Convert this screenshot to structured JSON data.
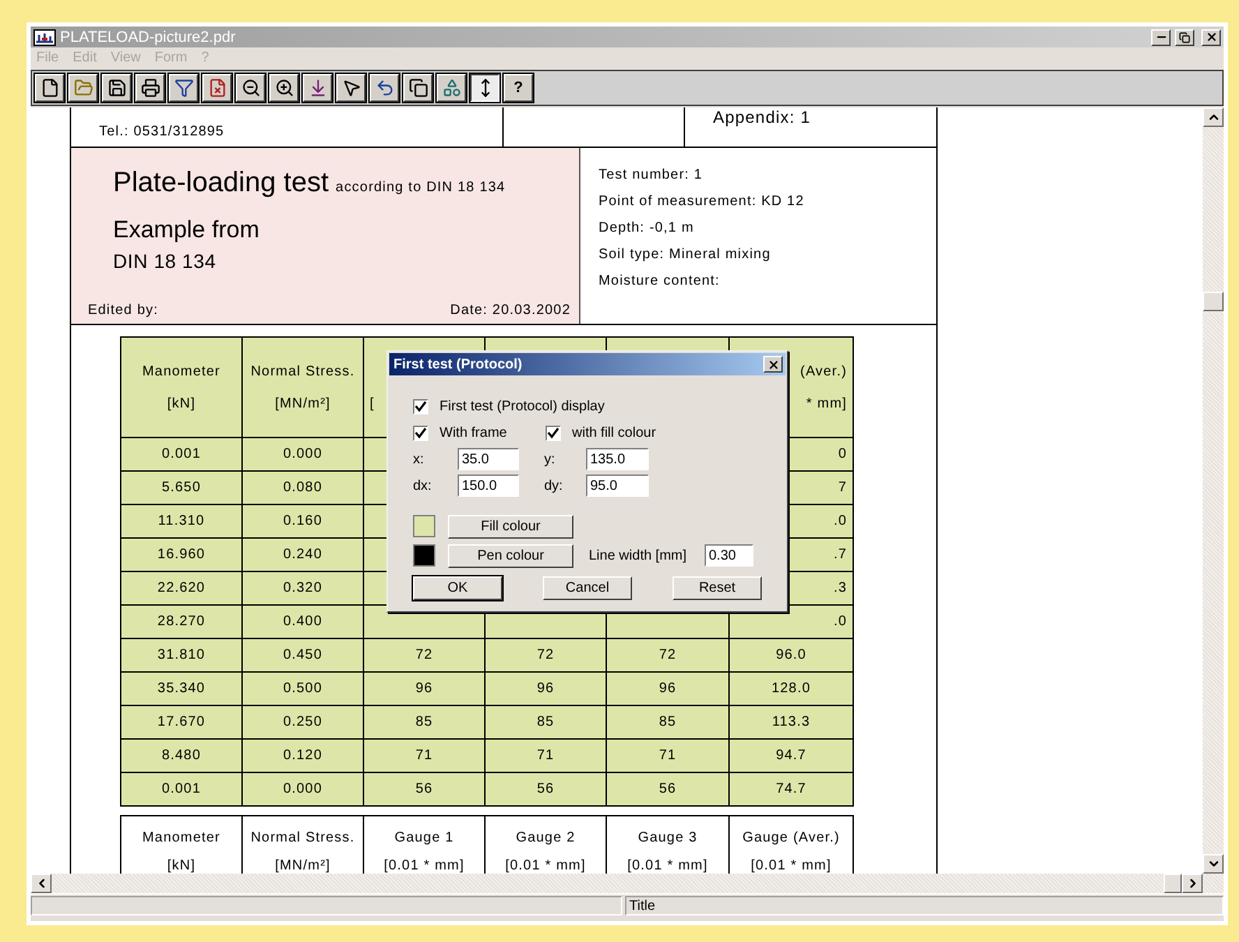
{
  "window": {
    "title": "PLATELOAD-picture2.pdr"
  },
  "menu": [
    {
      "label": "File",
      "disabled": true
    },
    {
      "label": "Edit",
      "disabled": true
    },
    {
      "label": "View",
      "disabled": true
    },
    {
      "label": "Form",
      "disabled": true
    },
    {
      "label": "?",
      "disabled": true
    }
  ],
  "toolbar": [
    {
      "kind": "new",
      "pressed": false
    },
    {
      "kind": "open",
      "pressed": false
    },
    {
      "kind": "save",
      "pressed": false
    },
    {
      "kind": "print",
      "pressed": false
    },
    {
      "kind": "filter",
      "pressed": false
    },
    {
      "kind": "delete",
      "pressed": false
    },
    {
      "kind": "zoom-out",
      "pressed": false
    },
    {
      "kind": "zoom-in",
      "pressed": false
    },
    {
      "kind": "insert",
      "pressed": false
    },
    {
      "kind": "pointer",
      "pressed": false
    },
    {
      "kind": "undo",
      "pressed": false
    },
    {
      "kind": "copy",
      "pressed": false
    },
    {
      "kind": "shapes",
      "pressed": false
    },
    {
      "kind": "updown",
      "pressed": true
    },
    {
      "kind": "text",
      "label": "?",
      "pressed": false
    }
  ],
  "document": {
    "header": {
      "phone": "Tel.: 0531/312895",
      "appendix": "Appendix: 1"
    },
    "title": {
      "heading": "Plate-loading test",
      "heading_note": "according to DIN 18 134",
      "subtitle": "Example from",
      "standard": "DIN 18 134",
      "edited_by": "Edited by:",
      "date": "Date:  20.03.2002"
    },
    "info": [
      "Test number:  1",
      "Point of measurement:  KD 12",
      "Depth:  -0,1 m",
      "Soil type:  Mineral mixing",
      "Moisture content:"
    ],
    "table": {
      "header": {
        "cells": [
          [
            "Manometer",
            "[kN]"
          ],
          [
            "Normal Stress.",
            "[MN/m²]"
          ],
          [
            null,
            "["
          ],
          [
            null,
            null
          ],
          [
            null,
            null
          ],
          [
            "(Aver.)",
            "* mm]"
          ]
        ]
      },
      "rows": [
        {
          "cells": [
            "0.001",
            "0.000",
            null,
            null,
            null,
            "0"
          ]
        },
        {
          "cells": [
            "5.650",
            "0.080",
            null,
            null,
            null,
            "7"
          ]
        },
        {
          "cells": [
            "11.310",
            "0.160",
            null,
            null,
            null,
            ".0"
          ]
        },
        {
          "cells": [
            "16.960",
            "0.240",
            null,
            null,
            null,
            ".7"
          ]
        },
        {
          "cells": [
            "22.620",
            "0.320",
            null,
            null,
            null,
            ".3"
          ]
        },
        {
          "cells": [
            "28.270",
            "0.400",
            null,
            null,
            null,
            ".0"
          ]
        },
        {
          "cells": [
            "31.810",
            "0.450",
            "72",
            "72",
            "72",
            "96.0"
          ]
        },
        {
          "cells": [
            "35.340",
            "0.500",
            "96",
            "96",
            "96",
            "128.0"
          ]
        },
        {
          "cells": [
            "17.670",
            "0.250",
            "85",
            "85",
            "85",
            "113.3"
          ]
        },
        {
          "cells": [
            "8.480",
            "0.120",
            "71",
            "71",
            "71",
            "94.7"
          ]
        },
        {
          "cells": [
            "0.001",
            "0.000",
            "56",
            "56",
            "56",
            "74.7"
          ]
        }
      ]
    },
    "table2": {
      "header": [
        [
          "Manometer",
          "[kN]"
        ],
        [
          "Normal Stress.",
          "[MN/m²]"
        ],
        [
          "Gauge 1",
          "[0.01 * mm]"
        ],
        [
          "Gauge 2",
          "[0.01 * mm]"
        ],
        [
          "Gauge 3",
          "[0.01 * mm]"
        ],
        [
          "Gauge (Aver.)",
          "[0.01 * mm]"
        ]
      ]
    }
  },
  "dialog": {
    "title": "First test (Protocol)",
    "display": {
      "label": "First test (Protocol) display",
      "checked": true
    },
    "with_frame": {
      "label": "With frame",
      "checked": true
    },
    "with_fill": {
      "label": "with fill colour",
      "checked": true
    },
    "fields": [
      {
        "label": "x:",
        "value": "35.0"
      },
      {
        "label": "y:",
        "value": "135.0"
      },
      {
        "label": "dx:",
        "value": "150.0"
      },
      {
        "label": "dy:",
        "value": "95.0"
      }
    ],
    "fill": {
      "label": "Fill colour",
      "color": "#dde6a8"
    },
    "pen": {
      "label": "Pen colour",
      "color": "#000000"
    },
    "line_width": {
      "label": "Line width [mm]",
      "value": "0.30"
    },
    "buttons": [
      {
        "label": "OK",
        "default": true
      },
      {
        "label": "Cancel",
        "default": false
      },
      {
        "label": "Reset",
        "default": false
      }
    ]
  },
  "status_bar": {
    "title": "Title"
  }
}
